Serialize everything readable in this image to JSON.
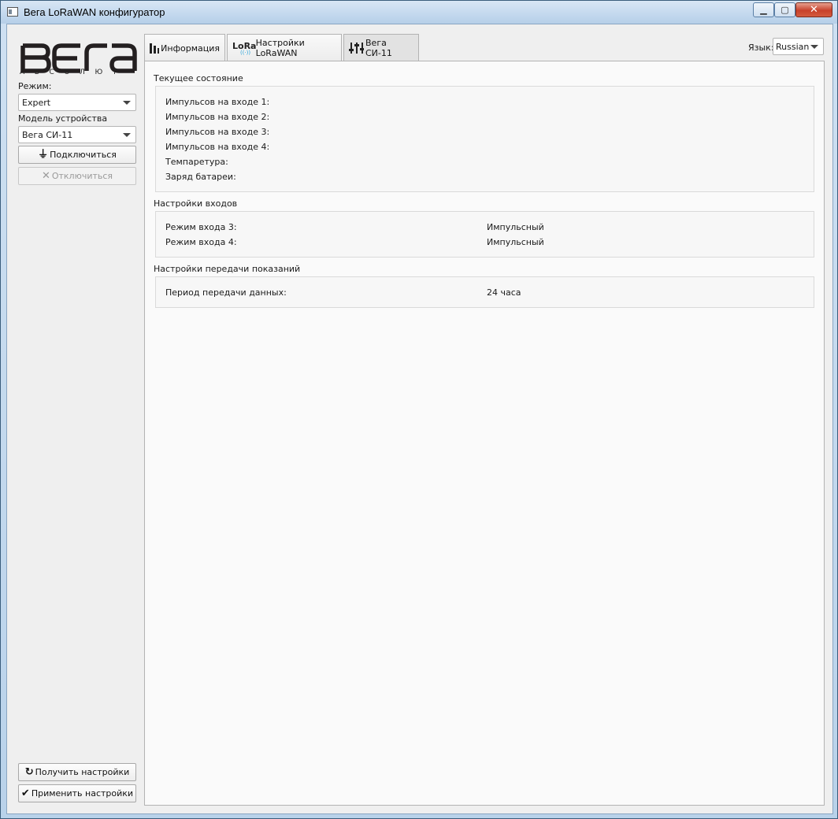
{
  "window": {
    "title": "Вега LoRaWAN конфигуратор",
    "min_icon": "minimize-icon",
    "max_icon": "maximize-icon",
    "close_icon": "close-icon"
  },
  "sidebar": {
    "logo_text": "ВЕГА",
    "logo_sub": "АБСОЛЮТ",
    "mode_label": "Режим:",
    "mode_value": "Expert",
    "model_label": "Модель устройства",
    "model_value": "Вега СИ-11",
    "connect_label": "Подключиться",
    "disconnect_label": "Отключиться",
    "get_settings_label": "Получить настройки",
    "apply_settings_label": "Применить настройки"
  },
  "tabs": [
    {
      "label": "Информация",
      "icon": "bar-chart-icon"
    },
    {
      "label": "Настройки LoRaWAN",
      "icon": "lora-icon",
      "icon_text": "LoRa"
    },
    {
      "label": "Вега СИ-11",
      "icon": "sliders-icon",
      "active": true
    }
  ],
  "language": {
    "label": "Язык:",
    "value": "Russian"
  },
  "sections": {
    "current_state": {
      "title": "Текущее состояние",
      "rows": [
        {
          "label": "Импульсов на входе 1:",
          "value": ""
        },
        {
          "label": "Импульсов на входе 2:",
          "value": ""
        },
        {
          "label": "Импульсов на входе 3:",
          "value": ""
        },
        {
          "label": "Импульсов на входе 4:",
          "value": ""
        },
        {
          "label": "Темпаретура:",
          "value": ""
        },
        {
          "label": "Заряд батареи:",
          "value": ""
        }
      ]
    },
    "inputs": {
      "title": "Настройки входов",
      "rows": [
        {
          "label": "Режим входа 3:",
          "value": "Импульсный"
        },
        {
          "label": "Режим входа 4:",
          "value": "Импульсный"
        }
      ]
    },
    "transmission": {
      "title": "Настройки передачи показаний",
      "rows": [
        {
          "label": "Период передачи данных:",
          "value": "24 часа"
        }
      ]
    }
  },
  "colors": {
    "frame": "#6fa2cc",
    "client_bg": "#efefef",
    "panel_bg": "#fafafa",
    "close_red": "#c8412b"
  }
}
